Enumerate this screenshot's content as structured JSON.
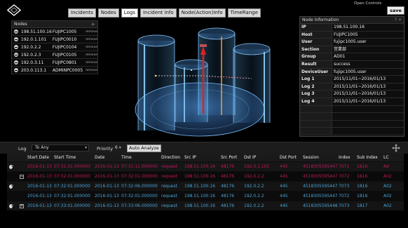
{
  "header": {
    "tabs": [
      "Incidents",
      "Nodes",
      "Logs",
      "Incident Info",
      "Node(Action)Info",
      "TimeRange"
    ],
    "active_tab": "Logs",
    "open_controls": "Open Controls",
    "save_label": "save"
  },
  "nodes_panel": {
    "title": "Nodes",
    "items": [
      {
        "ip": "198.51.100.16",
        "name": "FUJIPC1005",
        "action": "remove"
      },
      {
        "ip": "192.0.1.101",
        "name": "FUJIPC0010",
        "action": "remove"
      },
      {
        "ip": "192.0.2.2",
        "name": "FUJIPC0104",
        "action": "remove"
      },
      {
        "ip": "192.0.2.3",
        "name": "FUJIPC0105",
        "action": "remove"
      },
      {
        "ip": "192.0.3.11",
        "name": "FUJIPC0801",
        "action": "remove"
      },
      {
        "ip": "203.0.113.1",
        "name": "ADMINPC0005",
        "action": "remove"
      }
    ]
  },
  "node_info": {
    "title": "Node Information",
    "rows": [
      {
        "key": "IP",
        "value": "198.51.100.16"
      },
      {
        "key": "Host",
        "value": "FUJIPC1005"
      },
      {
        "key": "User",
        "value": "fujipc1005.user"
      },
      {
        "key": "Section",
        "value": "営業部"
      },
      {
        "key": "Group",
        "value": "AD01"
      },
      {
        "key": "Result",
        "value": "success"
      },
      {
        "key": "DeviceUser",
        "value": "fujipc1005.user"
      },
      {
        "key": "Log 1",
        "value": "2015/11/01~2016/01/13"
      },
      {
        "key": "Log 2",
        "value": "2015/11/01~2016/01/13"
      },
      {
        "key": "Log 3",
        "value": "2015/11/01~2016/01/13"
      },
      {
        "key": "Log 4",
        "value": "2015/11/01~2016/01/13"
      },
      {
        "key": "",
        "value": ""
      },
      {
        "key": "",
        "value": ""
      },
      {
        "key": "",
        "value": ""
      },
      {
        "key": "",
        "value": ""
      }
    ]
  },
  "filters": {
    "log_label": "Log",
    "log_value": "To Any",
    "priority_label": "Priority",
    "priority_value": "6",
    "auto_analyze": "Auto Analyze"
  },
  "log_table": {
    "columns": [
      "Start Date",
      "Start Time",
      "Date",
      "Time",
      "Direction",
      "Src IP",
      "Src Port",
      "Dst IP",
      "Dst Port",
      "Session",
      "Index",
      "Sub Index",
      "LC"
    ],
    "rows": [
      {
        "icon": "circle",
        "cells": [
          "2016-01-13",
          "07:31:01.000000",
          "2016-01-13",
          "07:31:11.000000",
          "request",
          "198.51.100.16",
          "48176",
          "192.0.1.101",
          "445",
          "4518305595447",
          "7071",
          "1816",
          "Ad"
        ],
        "style": "red"
      },
      {
        "icon": "minus",
        "cells": [
          "2016-01-13",
          "07:32:01.000000",
          "2016-01-13",
          "07:32:01.000000",
          "request",
          "198.51.100.16",
          "48176",
          "192.0.2.2",
          "445",
          "4518305595447",
          "7072",
          "1816",
          "A02"
        ],
        "style": "dark"
      },
      {
        "icon": "circle",
        "cells": [
          "2016-01-13",
          "07:32:01.000000",
          "2016-01-13",
          "07:32:06.000000",
          "request",
          "198.51.100.16",
          "48176",
          "192.0.2.2",
          "445",
          "4518305595447",
          "7073",
          "1816",
          "A02"
        ],
        "style": "blue"
      },
      {
        "icon": "none",
        "cells": [
          "2016-01-13",
          "07:32:01.000000",
          "2016-01-13",
          "07:32:01.000000",
          "request",
          "198.51.100.16",
          "48176",
          "192.0.2.2",
          "445",
          "4518305595447",
          "7072",
          "1816",
          "A02"
        ],
        "style": "blue2"
      },
      {
        "icon": "plus",
        "cells": [
          "2016-01-13",
          "07:33:01.000000",
          "2016-01-13",
          "07:33:06.000000",
          "request",
          "198.51.100.16",
          "48176",
          "192.0.2.2",
          "445",
          "4518305595448",
          "7073",
          "1817",
          "A02"
        ],
        "style": "blue"
      }
    ]
  },
  "colors": {
    "background": "#000000",
    "row_red": "#c2185b",
    "row_blue": "#4aa3d8",
    "cylinder": "#5ab4ff"
  }
}
